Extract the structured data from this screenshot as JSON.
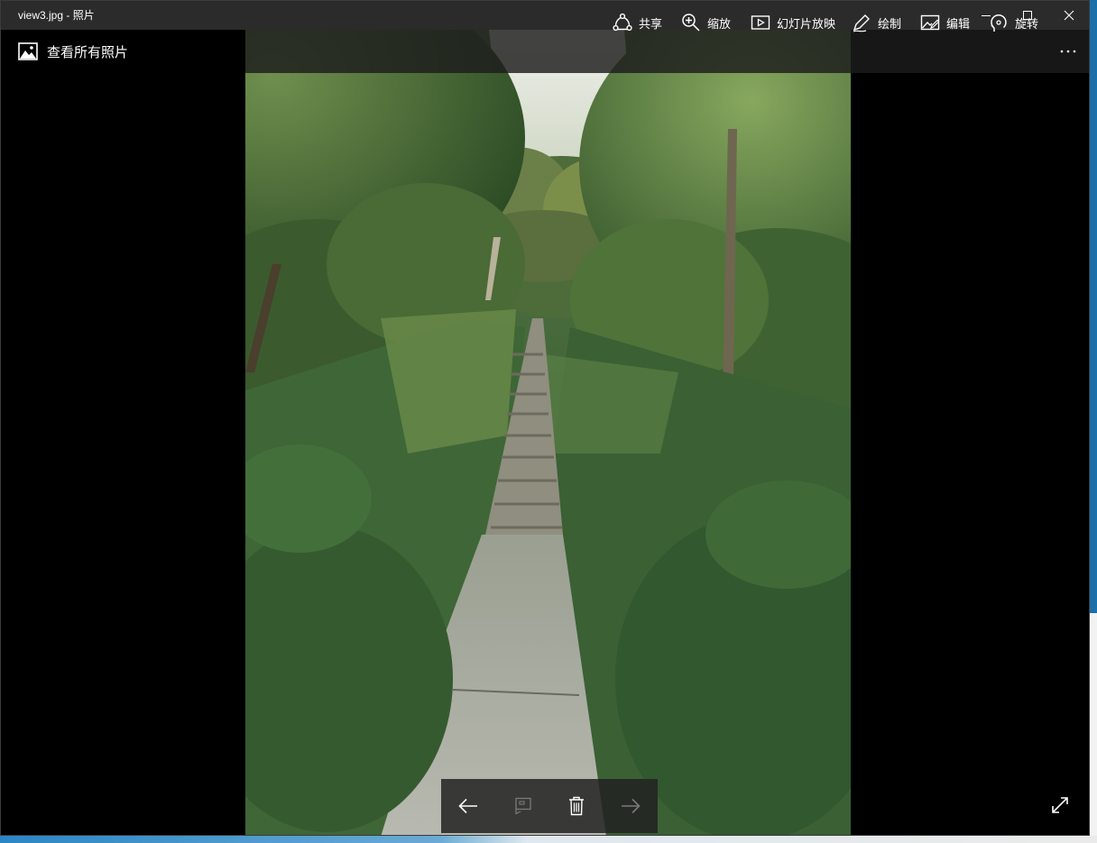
{
  "window": {
    "title": "view3.jpg - 照片",
    "controls": {
      "minimize": "minimize-icon",
      "maximize": "maximize-icon",
      "close": "close-icon"
    }
  },
  "backbar": {
    "label": "查看所有照片",
    "icon": "photos-app-icon"
  },
  "toolbar": {
    "share": "共享",
    "zoom": "缩放",
    "slideshow": "幻灯片放映",
    "draw": "绘制",
    "edit": "编辑",
    "rotate": "旋转",
    "more_icon": "more-icon"
  },
  "navigation": {
    "previous_icon": "arrow-left-icon",
    "compare_icon": "compare-icon",
    "delete_icon": "trash-icon",
    "next_icon": "arrow-right-icon",
    "fullscreen_icon": "expand-icon"
  },
  "colors": {
    "titlebar": "#2b2b2b",
    "background": "#000000",
    "text": "#ffffff",
    "disabled": "#7a7a7a"
  }
}
